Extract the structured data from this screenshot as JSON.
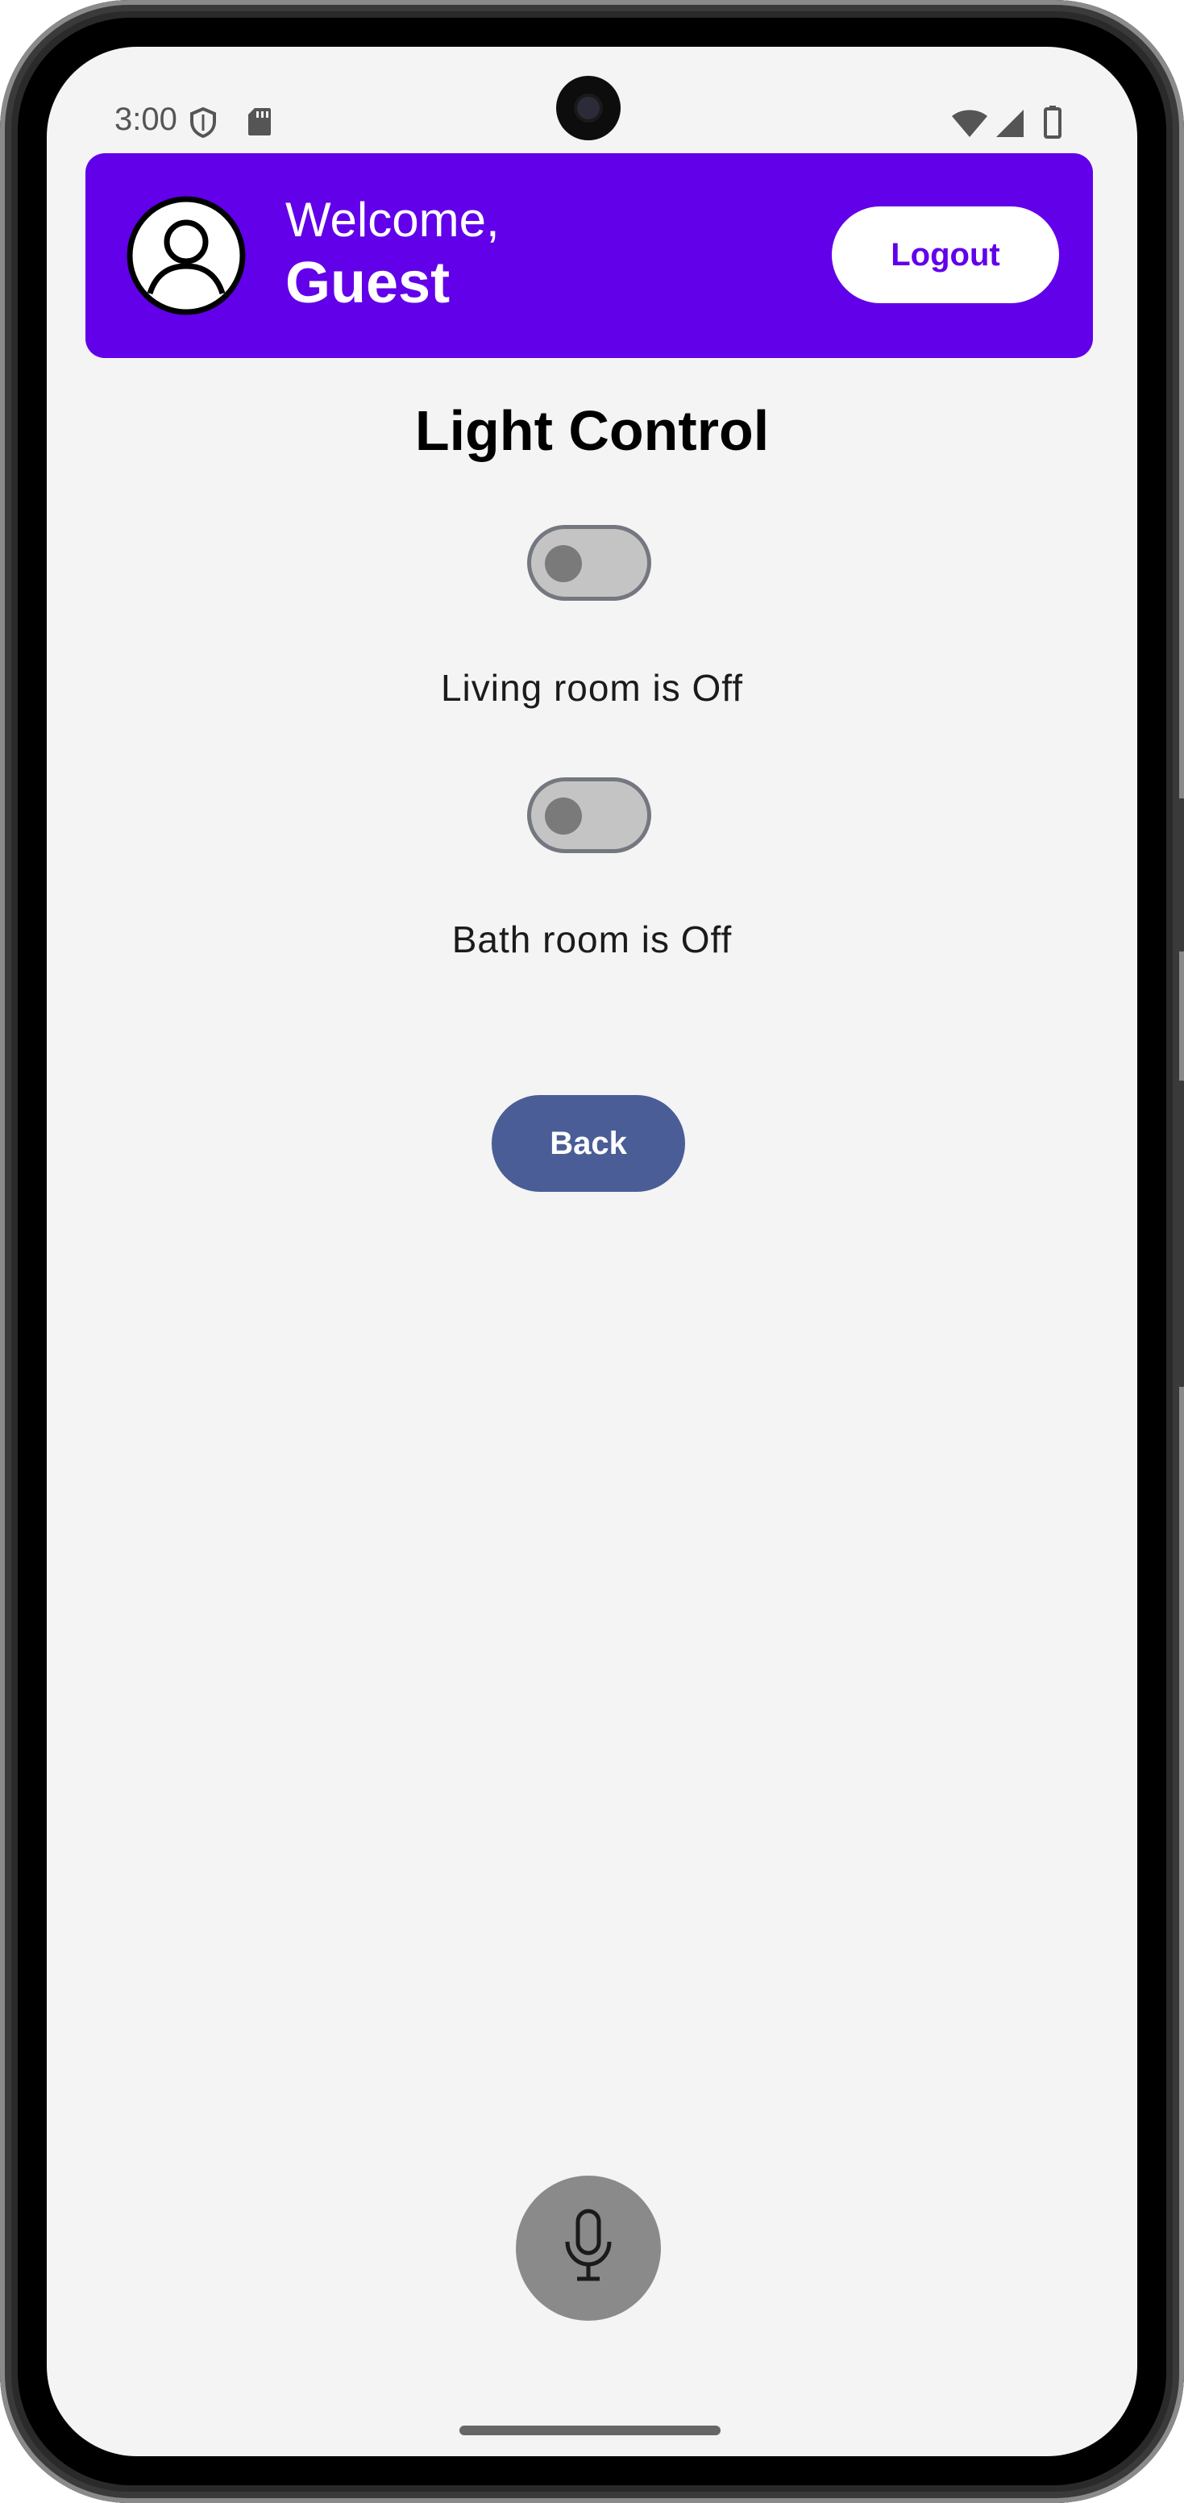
{
  "status_bar": {
    "time": "3:00",
    "icons_left": [
      "shield-icon",
      "sd-card-icon"
    ],
    "icons_right": [
      "wifi-icon",
      "cell-signal-icon",
      "battery-icon"
    ]
  },
  "header": {
    "welcome_label": "Welcome,",
    "user_name": "Guest",
    "logout_label": "Logout",
    "avatar_icon": "account-circle-icon",
    "background_color": "#6200ea"
  },
  "main": {
    "title": "Light Control",
    "rooms": [
      {
        "status_text": "Living room is Off",
        "switch_on": false
      },
      {
        "status_text": "Bath room is Off",
        "switch_on": false
      }
    ],
    "back_label": "Back",
    "back_color": "#4a5d96"
  },
  "fab": {
    "icon": "microphone-icon"
  }
}
